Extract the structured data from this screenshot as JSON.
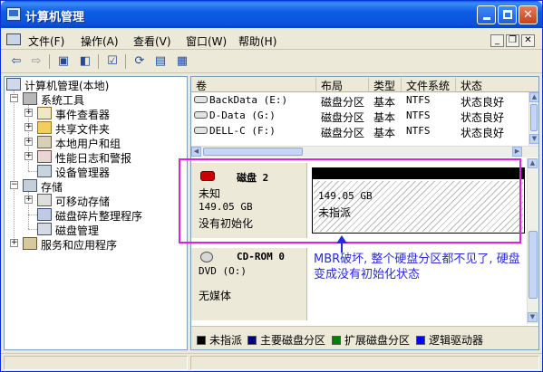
{
  "window": {
    "title": "计算机管理"
  },
  "menu": [
    "文件(F)",
    "操作(A)",
    "查看(V)",
    "窗口(W)",
    "帮助(H)"
  ],
  "tree": {
    "root": "计算机管理(本地)",
    "system_tools": "系统工具",
    "event_viewer": "事件查看器",
    "shared_folders": "共享文件夹",
    "local_users": "本地用户和组",
    "perf_logs": "性能日志和警报",
    "device_manager": "设备管理器",
    "storage": "存储",
    "removable_storage": "可移动存储",
    "defrag": "磁盘碎片整理程序",
    "disk_management": "磁盘管理",
    "services_apps": "服务和应用程序"
  },
  "volume_columns": [
    "卷",
    "布局",
    "类型",
    "文件系统",
    "状态"
  ],
  "volumes": [
    {
      "name": "BackData (E:)",
      "layout": "磁盘分区",
      "type": "基本",
      "fs": "NTFS",
      "status": "状态良好"
    },
    {
      "name": "D-Data (G:)",
      "layout": "磁盘分区",
      "type": "基本",
      "fs": "NTFS",
      "status": "状态良好"
    },
    {
      "name": "DELL-C (F:)",
      "layout": "磁盘分区",
      "type": "基本",
      "fs": "NTFS",
      "status": "状态良好"
    }
  ],
  "disk2": {
    "name": "磁盘 2",
    "kind": "未知",
    "size": "149.05 GB",
    "state": "没有初始化",
    "partition_size": "149.05 GB",
    "partition_state": "未指派"
  },
  "cdrom": {
    "name": "CD-ROM 0",
    "drive": "DVD (O:)",
    "media": "无媒体"
  },
  "legend": [
    {
      "label": "未指派",
      "color": "#000000"
    },
    {
      "label": "主要磁盘分区",
      "color": "#000080"
    },
    {
      "label": "扩展磁盘分区",
      "color": "#008000"
    },
    {
      "label": "逻辑驱动器",
      "color": "#0000ff"
    }
  ],
  "annotation": "MBR破坏, 整个硬盘分区都不见了, 硬盘变成没有初始化状态"
}
